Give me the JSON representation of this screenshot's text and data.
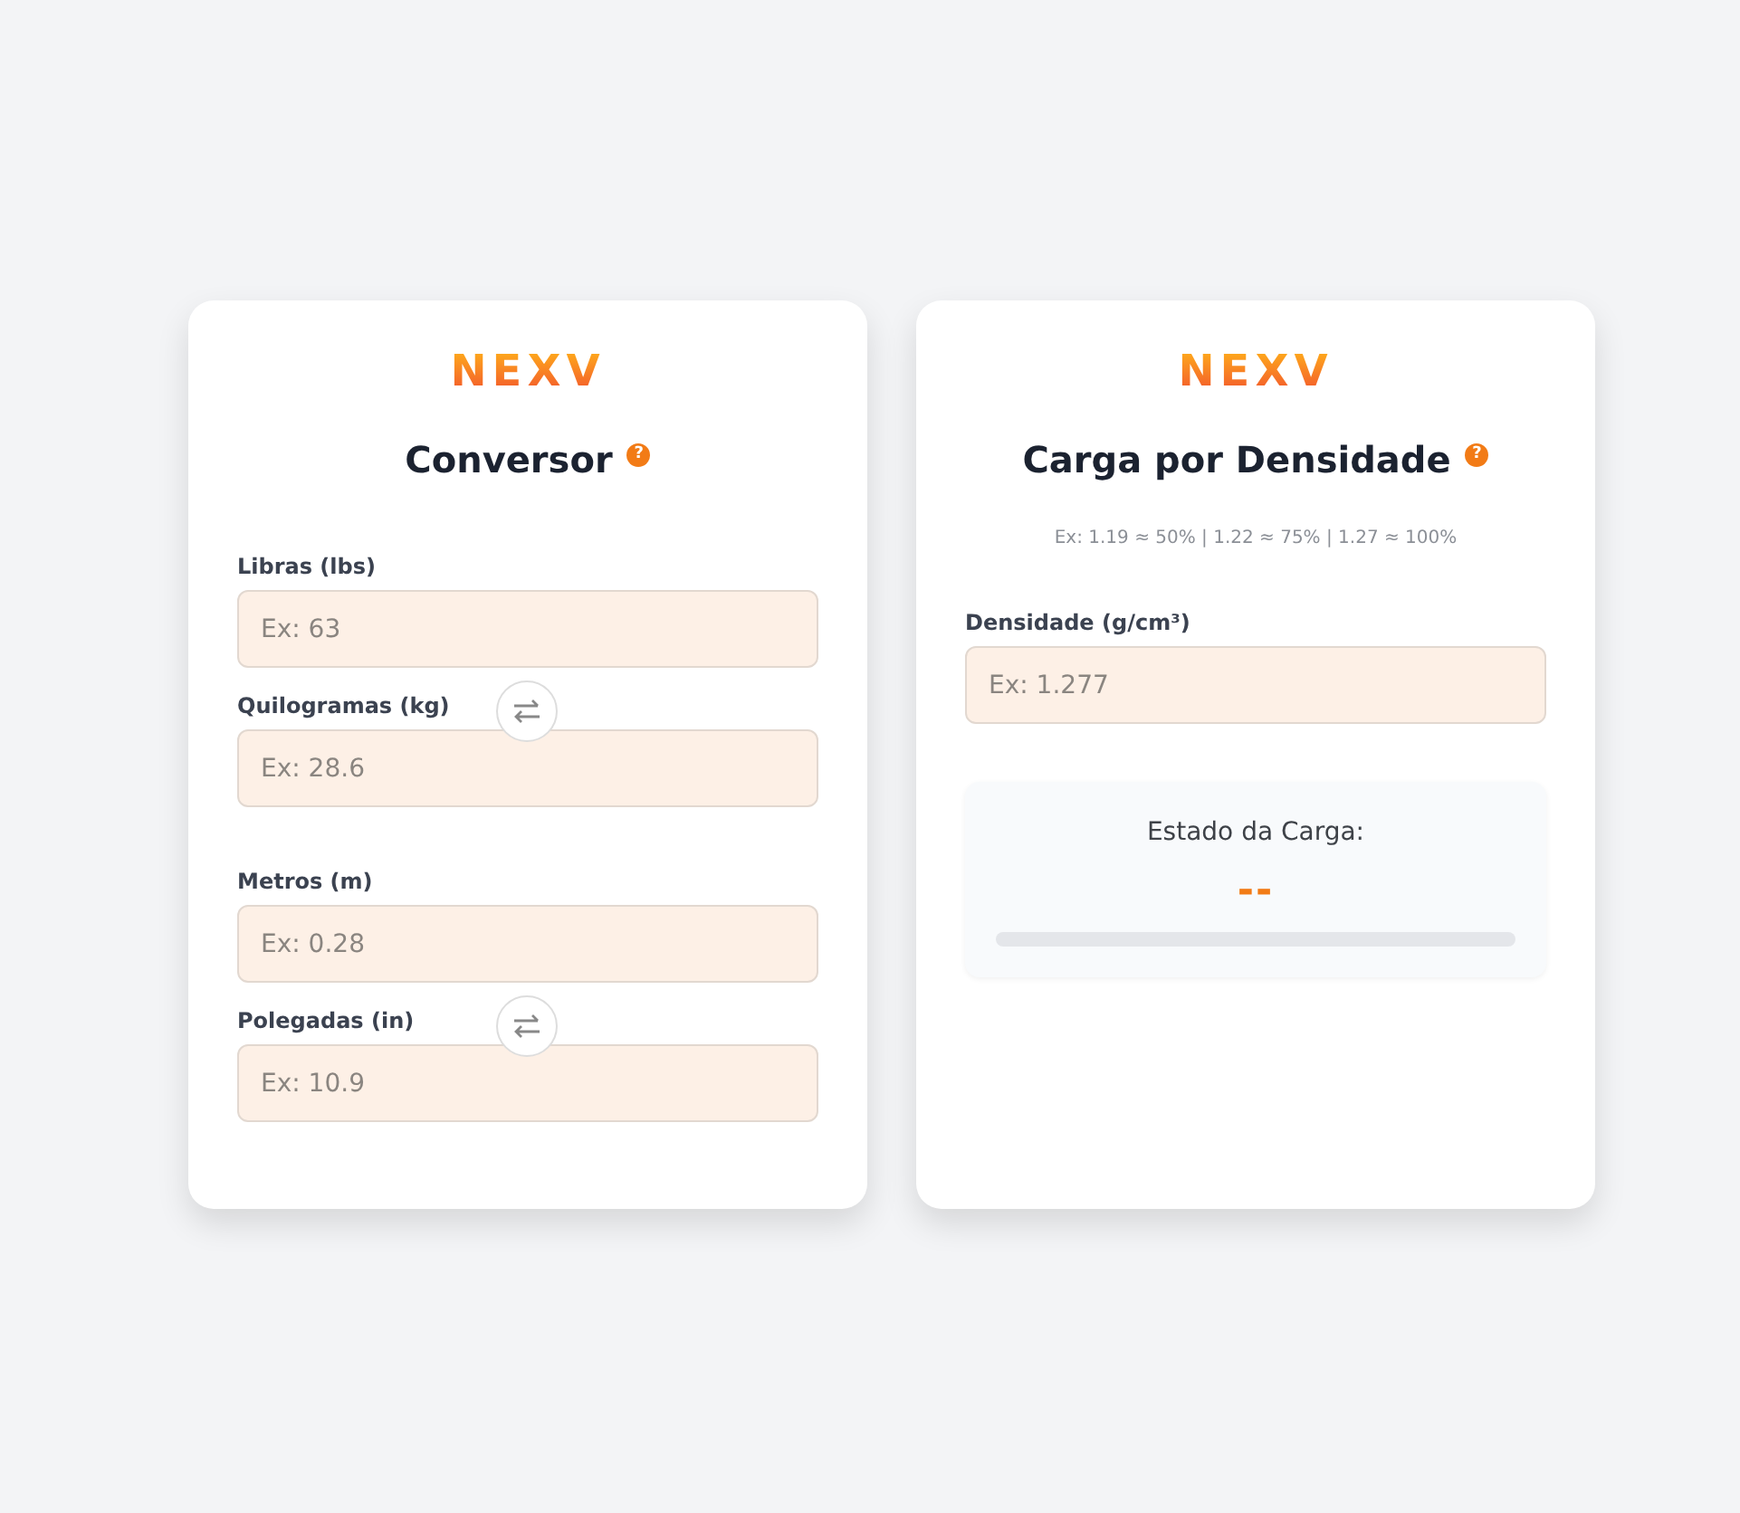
{
  "cards": [
    {
      "kind": "converter",
      "logo": "NEXV",
      "title": "Conversor",
      "help": "?",
      "groups": [
        {
          "fields": [
            {
              "label": "Libras (lbs)",
              "placeholder": "Ex: 63"
            },
            {
              "label": "Quilogramas (kg)",
              "placeholder": "Ex: 28.6"
            }
          ]
        },
        {
          "fields": [
            {
              "label": "Metros (m)",
              "placeholder": "Ex: 0.28"
            },
            {
              "label": "Polegadas (in)",
              "placeholder": "Ex: 10.9"
            }
          ]
        }
      ]
    },
    {
      "kind": "density",
      "logo": "NEXV",
      "title": "Carga por Densidade",
      "help": "?",
      "hint": "Ex: 1.19 ≈ 50% | 1.22 ≈ 75% | 1.27 ≈ 100%",
      "field": {
        "label": "Densidade (g/cm³)",
        "placeholder": "Ex: 1.277"
      },
      "status": {
        "label": "Estado da Carga:",
        "value": "--",
        "level": 0
      }
    }
  ]
}
